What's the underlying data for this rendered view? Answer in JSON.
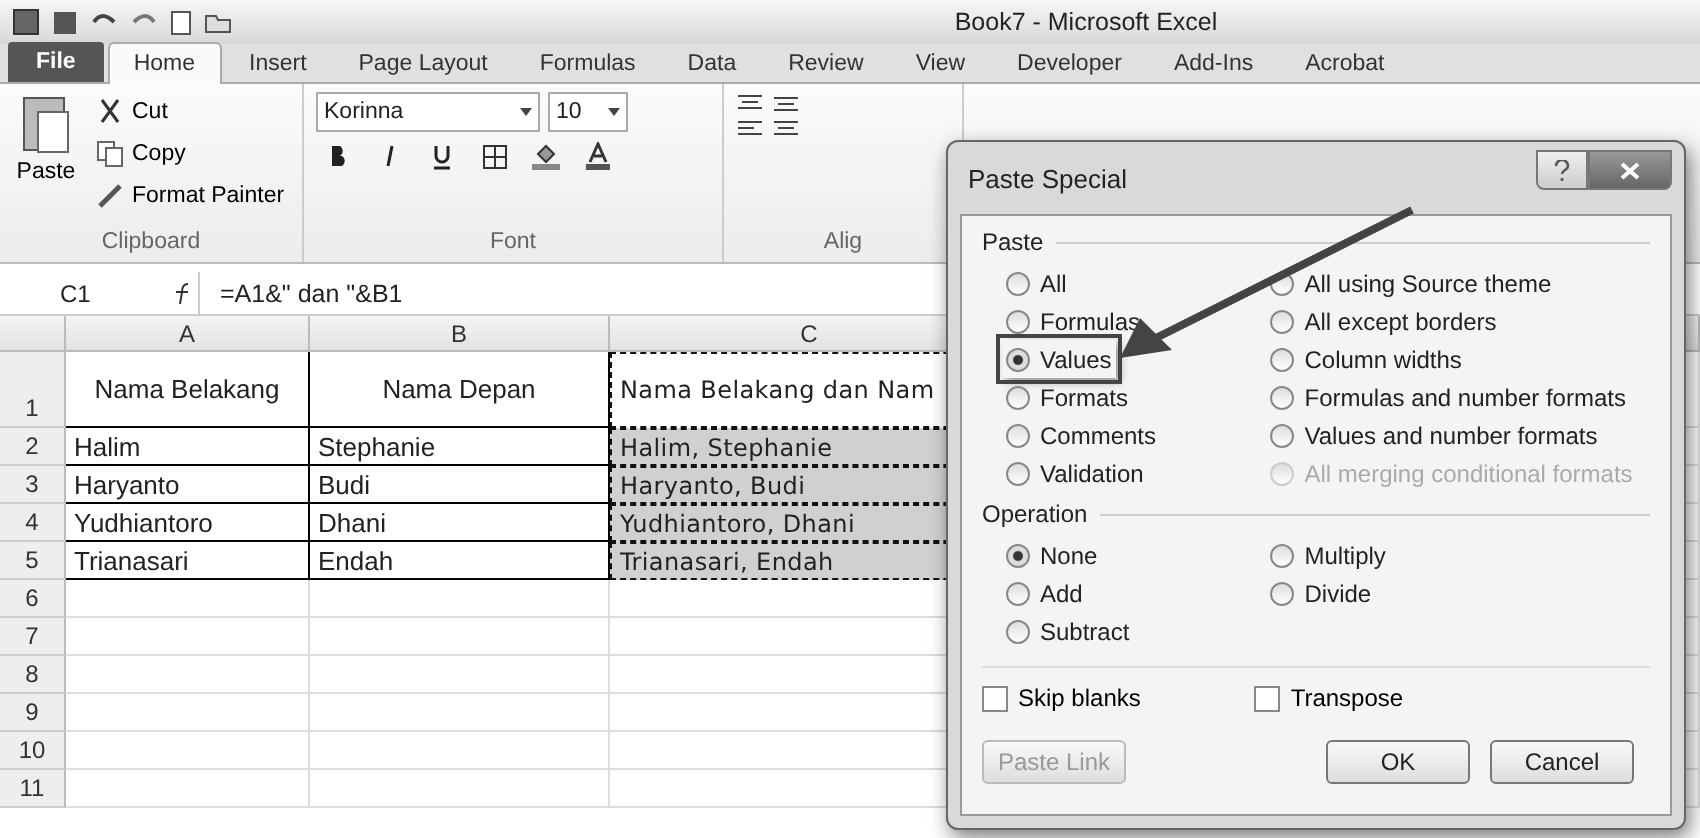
{
  "window": {
    "title": "Book7  -  Microsoft Excel"
  },
  "tabs": [
    {
      "label": "File",
      "kind": "file",
      "selected": false
    },
    {
      "label": "Home",
      "kind": "tab",
      "selected": true
    },
    {
      "label": "Insert",
      "kind": "tab",
      "selected": false
    },
    {
      "label": "Page Layout",
      "kind": "tab",
      "selected": false
    },
    {
      "label": "Formulas",
      "kind": "tab",
      "selected": false
    },
    {
      "label": "Data",
      "kind": "tab",
      "selected": false
    },
    {
      "label": "Review",
      "kind": "tab",
      "selected": false
    },
    {
      "label": "View",
      "kind": "tab",
      "selected": false
    },
    {
      "label": "Developer",
      "kind": "tab",
      "selected": false
    },
    {
      "label": "Add-Ins",
      "kind": "tab",
      "selected": false
    },
    {
      "label": "Acrobat",
      "kind": "tab",
      "selected": false
    }
  ],
  "ribbon": {
    "clipboard": {
      "paste": "Paste",
      "cut": "Cut",
      "copy": "Copy",
      "format_painter": "Format Painter",
      "label": "Clipboard"
    },
    "font": {
      "name": "Korinna",
      "size": "10",
      "label": "Font"
    },
    "alignment": {
      "label": "Alig"
    }
  },
  "formula_bar": {
    "cell": "C1",
    "formula": "=A1&\" dan \"&B1"
  },
  "sheet": {
    "columns": [
      "A",
      "B",
      "C"
    ],
    "rows": [
      {
        "number": "1",
        "cells": [
          {
            "text": "Nama Belakang",
            "selected": false,
            "copied": false
          },
          {
            "text": "Nama Depan",
            "selected": false,
            "copied": false
          },
          {
            "text": "Nama Belakang dan Nam",
            "selected": false,
            "copied": true
          }
        ]
      },
      {
        "number": "2",
        "cells": [
          {
            "text": "Halim",
            "selected": false,
            "copied": false
          },
          {
            "text": "Stephanie",
            "selected": false,
            "copied": false
          },
          {
            "text": "Halim, Stephanie",
            "selected": true,
            "copied": true
          }
        ]
      },
      {
        "number": "3",
        "cells": [
          {
            "text": "Haryanto",
            "selected": false,
            "copied": false
          },
          {
            "text": "Budi",
            "selected": false,
            "copied": false
          },
          {
            "text": "Haryanto, Budi",
            "selected": true,
            "copied": true
          }
        ]
      },
      {
        "number": "4",
        "cells": [
          {
            "text": "Yudhiantoro",
            "selected": false,
            "copied": false
          },
          {
            "text": "Dhani",
            "selected": false,
            "copied": false
          },
          {
            "text": "Yudhiantoro, Dhani",
            "selected": true,
            "copied": true
          }
        ]
      },
      {
        "number": "5",
        "cells": [
          {
            "text": "Trianasari",
            "selected": false,
            "copied": false
          },
          {
            "text": "Endah",
            "selected": false,
            "copied": false
          },
          {
            "text": "Trianasari, Endah",
            "selected": true,
            "copied": true
          }
        ]
      },
      {
        "number": "6",
        "cells": []
      },
      {
        "number": "7",
        "cells": []
      },
      {
        "number": "8",
        "cells": []
      },
      {
        "number": "9",
        "cells": []
      },
      {
        "number": "10",
        "cells": []
      },
      {
        "number": "11",
        "cells": []
      }
    ]
  },
  "dialog": {
    "title": "Paste Special",
    "paste": {
      "label": "Paste",
      "options": [
        {
          "label": "All",
          "selected": false,
          "disabled": false,
          "highlighted": false
        },
        {
          "label": "Formulas",
          "selected": false,
          "disabled": false,
          "highlighted": false
        },
        {
          "label": "Values",
          "selected": true,
          "disabled": false,
          "highlighted": true
        },
        {
          "label": "Formats",
          "selected": false,
          "disabled": false,
          "highlighted": false
        },
        {
          "label": "Comments",
          "selected": false,
          "disabled": false,
          "highlighted": false
        },
        {
          "label": "Validation",
          "selected": false,
          "disabled": false,
          "highlighted": false
        },
        {
          "label": "All using Source theme",
          "selected": false,
          "disabled": false,
          "highlighted": false
        },
        {
          "label": "All except borders",
          "selected": false,
          "disabled": false,
          "highlighted": false
        },
        {
          "label": "Column widths",
          "selected": false,
          "disabled": false,
          "highlighted": false
        },
        {
          "label": "Formulas and number formats",
          "selected": false,
          "disabled": false,
          "highlighted": false
        },
        {
          "label": "Values and number formats",
          "selected": false,
          "disabled": false,
          "highlighted": false
        },
        {
          "label": "All merging conditional formats",
          "selected": false,
          "disabled": true,
          "highlighted": false
        }
      ]
    },
    "operation": {
      "label": "Operation",
      "options": [
        {
          "label": "None",
          "selected": true
        },
        {
          "label": "Add",
          "selected": false
        },
        {
          "label": "Subtract",
          "selected": false
        },
        {
          "label": "Multiply",
          "selected": false
        },
        {
          "label": "Divide",
          "selected": false
        }
      ]
    },
    "checkboxes": [
      {
        "label": "Skip blanks",
        "checked": false
      },
      {
        "label": "Transpose",
        "checked": false
      }
    ],
    "buttons": [
      {
        "label": "Paste Link",
        "disabled": true
      },
      {
        "label": "OK",
        "disabled": false
      },
      {
        "label": "Cancel",
        "disabled": false
      }
    ]
  }
}
